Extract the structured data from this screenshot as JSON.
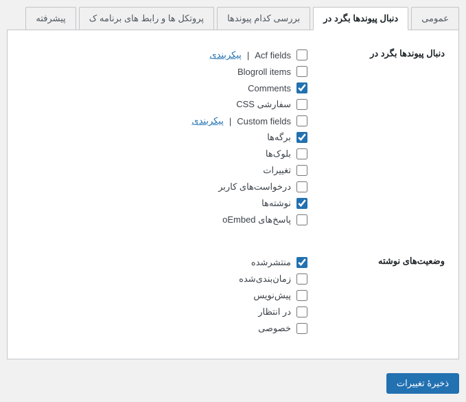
{
  "tabs": {
    "general": "عمومی",
    "look_for_links": "دنبال پیوندها بگرد در",
    "which_links": "بررسی کدام پیوندها",
    "protocols": "پروتکل ها و رابط های برنامه ک",
    "advanced": "پیشرفته"
  },
  "sections": {
    "look_for_links": "دنبال پیوندها بگرد در",
    "post_statuses": "وضعیت‌های نوشته"
  },
  "config_link": "پیکربندی",
  "link_options": [
    {
      "id": "acf",
      "label": "Acf fields",
      "checked": false,
      "config": true
    },
    {
      "id": "blogroll",
      "label": "Blogroll items",
      "checked": false,
      "config": false
    },
    {
      "id": "comments",
      "label": "Comments",
      "checked": true,
      "config": false
    },
    {
      "id": "css",
      "label": "CSS سفارشی",
      "checked": false,
      "config": false
    },
    {
      "id": "customfields",
      "label": "Custom fields",
      "checked": false,
      "config": true
    },
    {
      "id": "pages",
      "label": "برگه‌ها",
      "checked": true,
      "config": false
    },
    {
      "id": "blocks",
      "label": "بلوک‌ها",
      "checked": false,
      "config": false
    },
    {
      "id": "changes",
      "label": "تغییرات",
      "checked": false,
      "config": false
    },
    {
      "id": "requests",
      "label": "درخواست‌های کاربر",
      "checked": false,
      "config": false
    },
    {
      "id": "posts",
      "label": "نوشته‌ها",
      "checked": true,
      "config": false
    },
    {
      "id": "oembed",
      "label": "پاسخ‌های oEmbed",
      "checked": false,
      "config": false
    }
  ],
  "status_options": [
    {
      "id": "published",
      "label": "منتشرشده",
      "checked": true
    },
    {
      "id": "scheduled",
      "label": "زمان‌بندی‌شده",
      "checked": false
    },
    {
      "id": "draft",
      "label": "پیش‌نویس",
      "checked": false
    },
    {
      "id": "pending",
      "label": "در انتظار",
      "checked": false
    },
    {
      "id": "private",
      "label": "خصوصی",
      "checked": false
    }
  ],
  "save_button": "ذخیرۀ تغییرات"
}
